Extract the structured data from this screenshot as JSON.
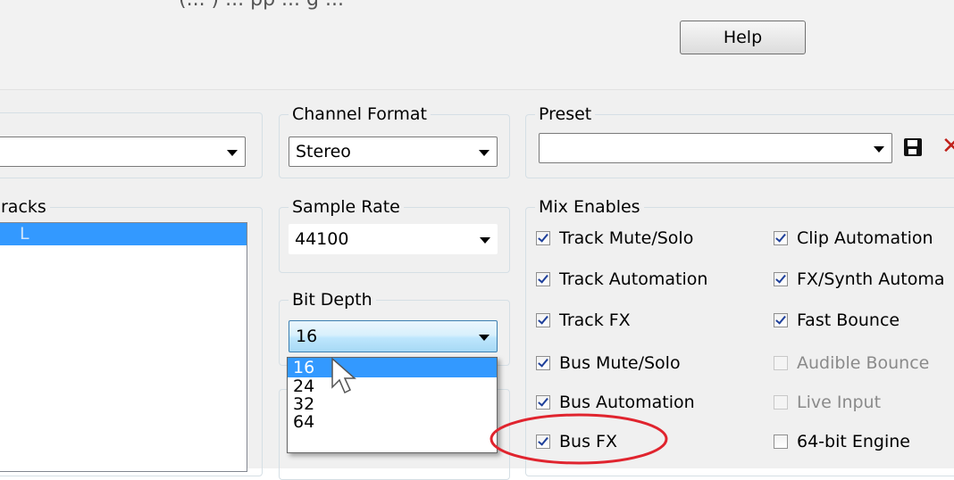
{
  "window": {
    "caption_fragment": "(... ) ... pp ... g ...",
    "help_label": "Help"
  },
  "groups": {
    "left_top": {
      "legend": "",
      "combo_value": ""
    },
    "tracks": {
      "legend": "racks",
      "selected_item": "L"
    },
    "channel_format": {
      "legend": "Channel Format",
      "value": "Stereo"
    },
    "sample_rate": {
      "legend": "Sample Rate",
      "value": "44100"
    },
    "bit_depth": {
      "legend": "Bit Depth",
      "value": "16",
      "options": [
        "16",
        "24",
        "32",
        "64"
      ],
      "highlighted_option": "16"
    },
    "preset": {
      "legend": "Preset",
      "value": ""
    },
    "mix_enables": {
      "legend": "Mix Enables",
      "left_column": [
        {
          "label": "Track Mute/Solo",
          "checked": true,
          "enabled": true
        },
        {
          "label": "Track Automation",
          "checked": true,
          "enabled": true
        },
        {
          "label": "Track FX",
          "checked": true,
          "enabled": true
        },
        {
          "label": "Bus Mute/Solo",
          "checked": true,
          "enabled": true
        },
        {
          "label": "Bus Automation",
          "checked": true,
          "enabled": true
        },
        {
          "label": "Bus FX",
          "checked": true,
          "enabled": true
        }
      ],
      "right_column": [
        {
          "label": "Clip Automation",
          "checked": true,
          "enabled": true
        },
        {
          "label": "FX/Synth Automa",
          "checked": true,
          "enabled": true
        },
        {
          "label": "Fast Bounce",
          "checked": true,
          "enabled": true
        },
        {
          "label": "Audible Bounce",
          "checked": false,
          "enabled": false
        },
        {
          "label": "Live Input",
          "checked": false,
          "enabled": false
        },
        {
          "label": "64-bit Engine",
          "checked": false,
          "enabled": true
        }
      ]
    }
  },
  "icons": {
    "save": "floppy-disk-icon",
    "delete": "red-x-icon",
    "cursor": "mouse-pointer-icon"
  },
  "colors": {
    "selection": "#3399ff",
    "annotation_ellipse": "#e0242e",
    "delete_icon": "#c0201a",
    "checkmark": "#1e3f9a"
  }
}
